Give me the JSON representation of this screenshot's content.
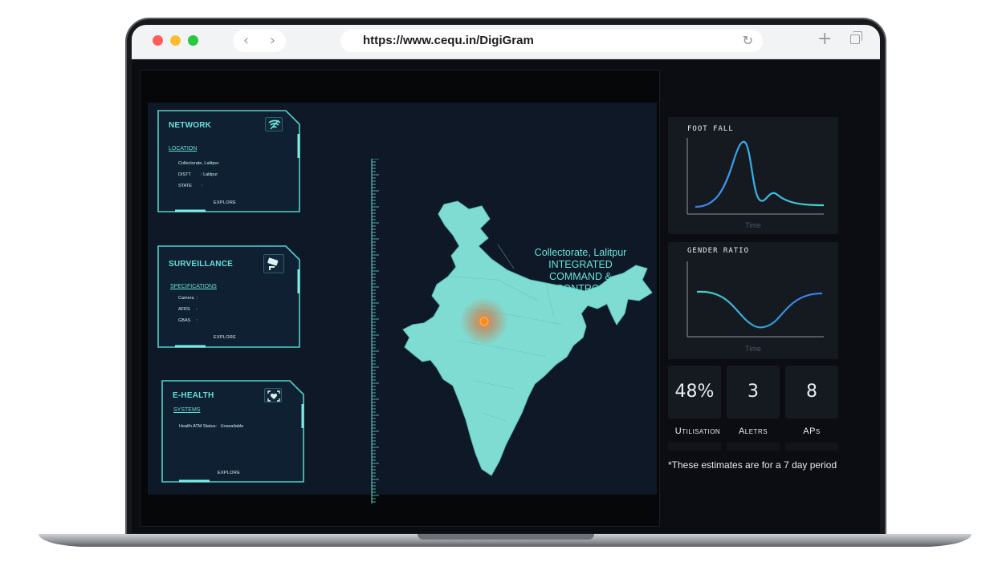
{
  "browser": {
    "url": "https://www.cequ.in/DigiGram",
    "back_icon": "chevron-left-icon",
    "forward_icon": "chevron-right-icon",
    "reload_icon": "reload-icon",
    "new_tab_icon": "plus-icon",
    "tabs_icon": "tabs-icon"
  },
  "cards": {
    "network": {
      "title": "NETWORK",
      "section": "LOCATION",
      "lines": [
        "Collectorate, Lalitpur",
        "DISTT        : Lalitpur",
        "STATE        :"
      ],
      "explore": "EXPLORE",
      "icon": "wifi-icon"
    },
    "surveillance": {
      "title": "SURVEILLANCE",
      "section": "SPECIFICATIONS",
      "lines": [
        "Camera  :",
        "AFRS     :",
        "GBAS     :"
      ],
      "explore": "EXPLORE",
      "icon": "camera-icon"
    },
    "ehealth": {
      "title": "E-HEALTH",
      "section": "SYSTEMS",
      "lines": [
        "Health ATM Status:   Unavailable"
      ],
      "explore": "EXPLORE",
      "icon": "health-scan-icon"
    }
  },
  "map": {
    "caption_line1": "Collectorate, Lalitpur",
    "caption_line2": "INTEGRATED",
    "caption_line3": "COMMAND &",
    "caption_line4": "CONTROL",
    "marker_color": "#ff8a1c",
    "land_color": "#7fdcd2"
  },
  "widgets": {
    "foot_fall": {
      "title": "FOOT FALL",
      "xlabel": "Time"
    },
    "gender_ratio": {
      "title": "GENDER RATIO",
      "xlabel": "Time"
    }
  },
  "stats": [
    {
      "value": "48%",
      "label": "Utilisation"
    },
    {
      "value": "3",
      "label": "Aletrs"
    },
    {
      "value": "8",
      "label": "APs"
    }
  ],
  "footnote": "*These estimates are for a 7 day period",
  "colors": {
    "accent": "#66e0d8",
    "background": "#0b0d12",
    "panel": "#0f1826"
  }
}
